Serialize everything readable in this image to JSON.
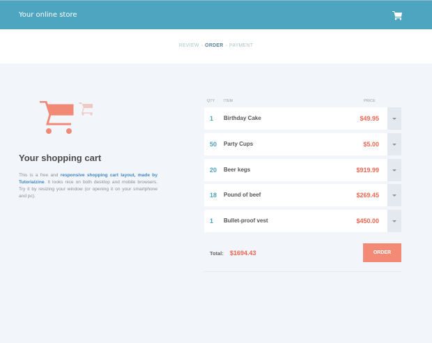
{
  "header": {
    "title": "Your online store",
    "cart_icon": "cart-icon"
  },
  "steps": {
    "review": "REVIEW",
    "order": "ORDER",
    "payment": "PAYMENT",
    "separator": "›"
  },
  "intro": {
    "title": "Your shopping cart",
    "text_before": "This is a free and ",
    "link": "responsive shopping cart layout, made by Tutorialzine",
    "text_after": ". It looks nice on both desktop and mobile browsers. Try it by resizing your window (or opening it on your smartphone and pc)."
  },
  "table": {
    "headers": {
      "qty": "QTY",
      "item": "ITEM",
      "price": "PRICE"
    },
    "rows": [
      {
        "qty": "1",
        "name": "Birthday Cake",
        "price": "$49.95"
      },
      {
        "qty": "50",
        "name": "Party Cups",
        "price": "$5.00"
      },
      {
        "qty": "20",
        "name": "Beer kegs",
        "price": "$919.99"
      },
      {
        "qty": "18",
        "name": "Pound of beef",
        "price": "$269.45"
      },
      {
        "qty": "1",
        "name": "Bullet-proof vest",
        "price": "$450.00"
      }
    ]
  },
  "total": {
    "label": "Total:",
    "value": "$1694.43"
  },
  "order_button": "ORDER",
  "colors": {
    "header": "#4ea5bf",
    "accent": "#eb6651",
    "button": "#f28a76",
    "qty": "#4e9fc0"
  }
}
